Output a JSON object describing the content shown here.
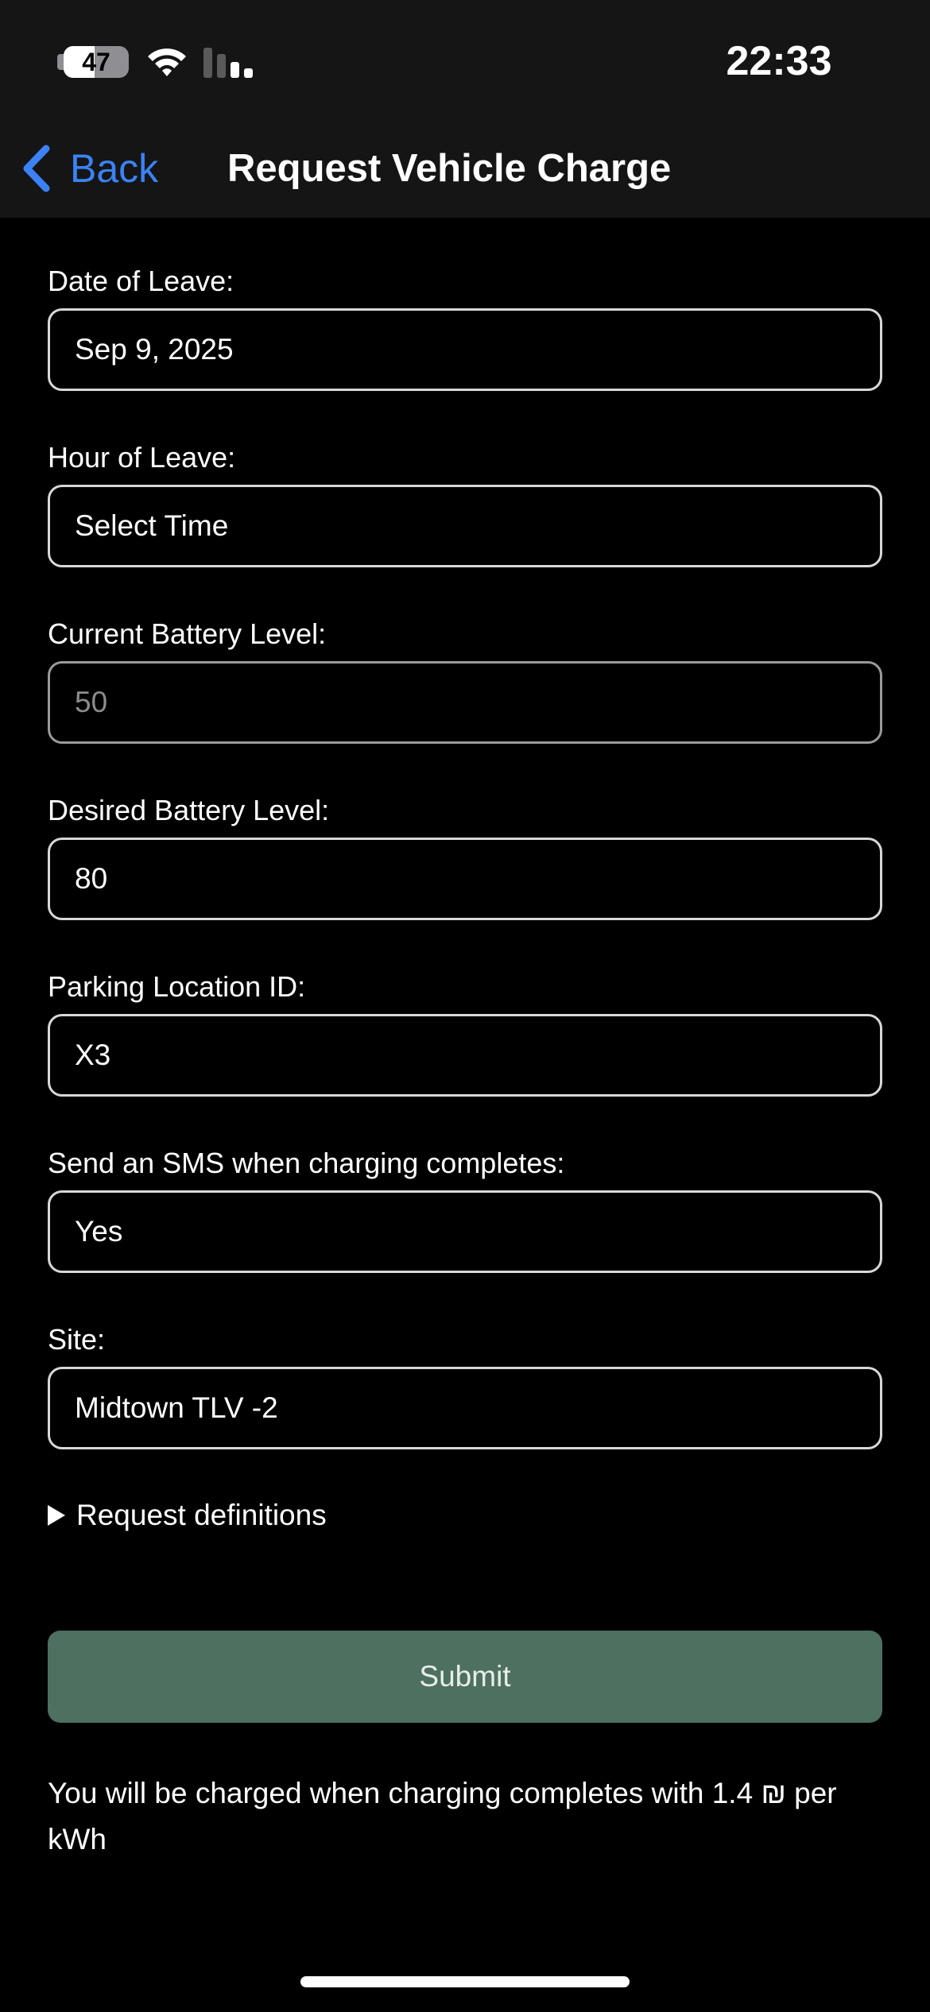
{
  "status_bar": {
    "time": "22:33",
    "battery_level": "47",
    "battery_fraction": 0.47
  },
  "nav": {
    "back_label": "Back",
    "title": "Request Vehicle Charge"
  },
  "form": {
    "date_of_leave": {
      "label": "Date of Leave:",
      "value": "Sep 9, 2025"
    },
    "hour_of_leave": {
      "label": "Hour of Leave:",
      "value": "Select Time"
    },
    "current_battery": {
      "label": "Current Battery Level:",
      "value": "50"
    },
    "desired_battery": {
      "label": "Desired Battery Level:",
      "value": "80"
    },
    "parking_location": {
      "label": "Parking Location ID:",
      "value": "X3"
    },
    "sms": {
      "label": "Send an SMS when charging completes:",
      "value": "Yes"
    },
    "site": {
      "label": "Site:",
      "value": "Midtown TLV -2"
    }
  },
  "definitions_label": "Request definitions",
  "submit_label": "Submit",
  "note": "You will be charged when charging completes with 1.4 ₪ per kWh",
  "colors": {
    "accent_blue": "#3b82f6",
    "submit_green": "#4d7060",
    "bar_background": "#151515"
  }
}
